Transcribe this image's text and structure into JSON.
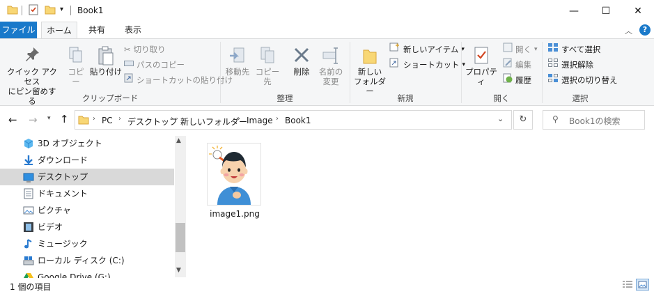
{
  "window": {
    "title": "Book1",
    "controls": {
      "minimize": "—",
      "maximize": "☐",
      "close": "✕"
    }
  },
  "tabs": {
    "file": "ファイル",
    "home": "ホーム",
    "share": "共有",
    "view": "表示"
  },
  "ribbon": {
    "clipboard": {
      "label": "クリップボード",
      "pin": "クイック アクセス\nにピン留めする",
      "pin1": "クイック アクセス",
      "pin2": "にピン留めする",
      "copy": "コピー",
      "paste": "貼り付け",
      "cut": "切り取り",
      "copy_path": "パスのコピー",
      "paste_shortcut": "ショートカットの貼り付け"
    },
    "organize": {
      "label": "整理",
      "move_to": "移動先",
      "copy_to": "コピー先",
      "delete": "削除",
      "rename1": "名前の",
      "rename2": "変更"
    },
    "new": {
      "label": "新規",
      "new_folder1": "新しい",
      "new_folder2": "フォルダー",
      "new_item": "新しいアイテム",
      "shortcut": "ショートカット"
    },
    "open": {
      "label": "開く",
      "properties": "プロパティ",
      "open": "開く",
      "edit": "編集",
      "history": "履歴"
    },
    "select": {
      "label": "選択",
      "select_all": "すべて選択",
      "select_none": "選択解除",
      "invert": "選択の切り替え"
    }
  },
  "address": {
    "crumbs": [
      "PC",
      "デスクトップ",
      "新しいフォルダー",
      "Image",
      "Book1"
    ],
    "search_placeholder": "Book1の検索"
  },
  "nav": {
    "items": [
      {
        "label": "3D オブジェクト",
        "icon": "3d-objects-icon"
      },
      {
        "label": "ダウンロード",
        "icon": "downloads-icon"
      },
      {
        "label": "デスクトップ",
        "icon": "desktop-icon",
        "selected": true
      },
      {
        "label": "ドキュメント",
        "icon": "documents-icon"
      },
      {
        "label": "ピクチャ",
        "icon": "pictures-icon"
      },
      {
        "label": "ビデオ",
        "icon": "videos-icon"
      },
      {
        "label": "ミュージック",
        "icon": "music-icon"
      },
      {
        "label": "ローカル ディスク (C:)",
        "icon": "local-disk-icon"
      },
      {
        "label": "Google Drive (G:)",
        "icon": "google-drive-icon"
      }
    ]
  },
  "files": [
    {
      "name": "image1.png"
    }
  ],
  "status": {
    "count": "1 個の項目"
  },
  "colors": {
    "file_tab": "#1979ca",
    "help": "#1979ca",
    "selected_nav": "#d9d9d9",
    "ribbon_bg": "#f5f6f7"
  }
}
